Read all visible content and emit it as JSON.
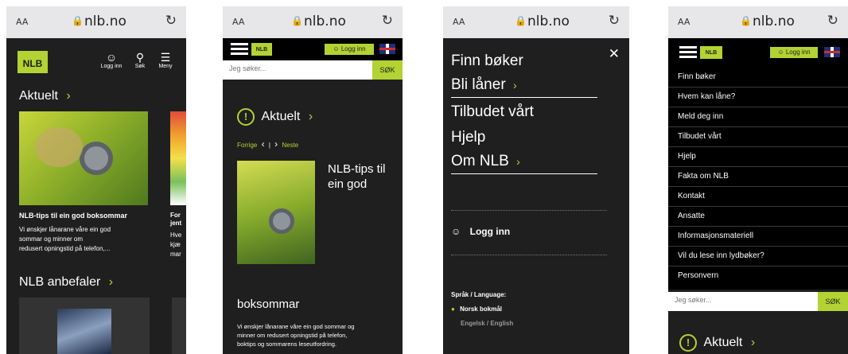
{
  "browser": {
    "aa": "AA",
    "host": "nlb.no"
  },
  "s1": {
    "logo": "NLB",
    "icons": {
      "login": "Logg inn",
      "search": "Søk",
      "menu": "Meny"
    },
    "section1": "Aktuelt",
    "card_title": "NLB-tips til ein god boksommar",
    "card_text1": "Vi ønskjer lånarane våre ein god",
    "card_text2": "sommar og minner om",
    "card_text3": "redusert opningstid på telefon,...",
    "peek_title1": "For",
    "peek_title2": "jent",
    "peek_text1": "Hve",
    "peek_text2": "kjæ",
    "peek_text3": "mar",
    "section2": "NLB anbefaler"
  },
  "s2": {
    "logo": "NLB",
    "login": "Logg inn",
    "search_placeholder": "Jeg søker...",
    "search_button": "SØK",
    "aktuelt": "Aktuelt",
    "prev": "Forrige",
    "next": "Neste",
    "headline1": "NLB-tips til",
    "headline2": "ein god",
    "headline3": "boksommar",
    "body1": "Vi ønskjer lånarane våre ein god sommar og",
    "body2": "minner om redusert opningstid på telefon,",
    "body3": "boktips og sommarens leseutfordring."
  },
  "s3": {
    "items": [
      "Finn bøker",
      "Bli låner",
      "Tilbudet vårt",
      "Hjelp",
      "Om NLB"
    ],
    "login": "Logg inn",
    "lang_heading": "Språk / Language:",
    "lang_active": "Norsk bokmål",
    "lang_other": "Engelsk / English"
  },
  "s4": {
    "logo": "NLB",
    "login": "Logg inn",
    "items": [
      "Finn bøker",
      "Hvem kan låne?",
      "Meld deg inn",
      "Tilbudet vårt",
      "Hjelp",
      "Fakta om NLB",
      "Kontakt",
      "Ansatte",
      "Informasjonsmateriell",
      "Vil du lese inn lydbøker?",
      "Personvern"
    ],
    "search_placeholder": "Jeg søker...",
    "search_button": "SØK",
    "aktuelt": "Aktuelt"
  }
}
